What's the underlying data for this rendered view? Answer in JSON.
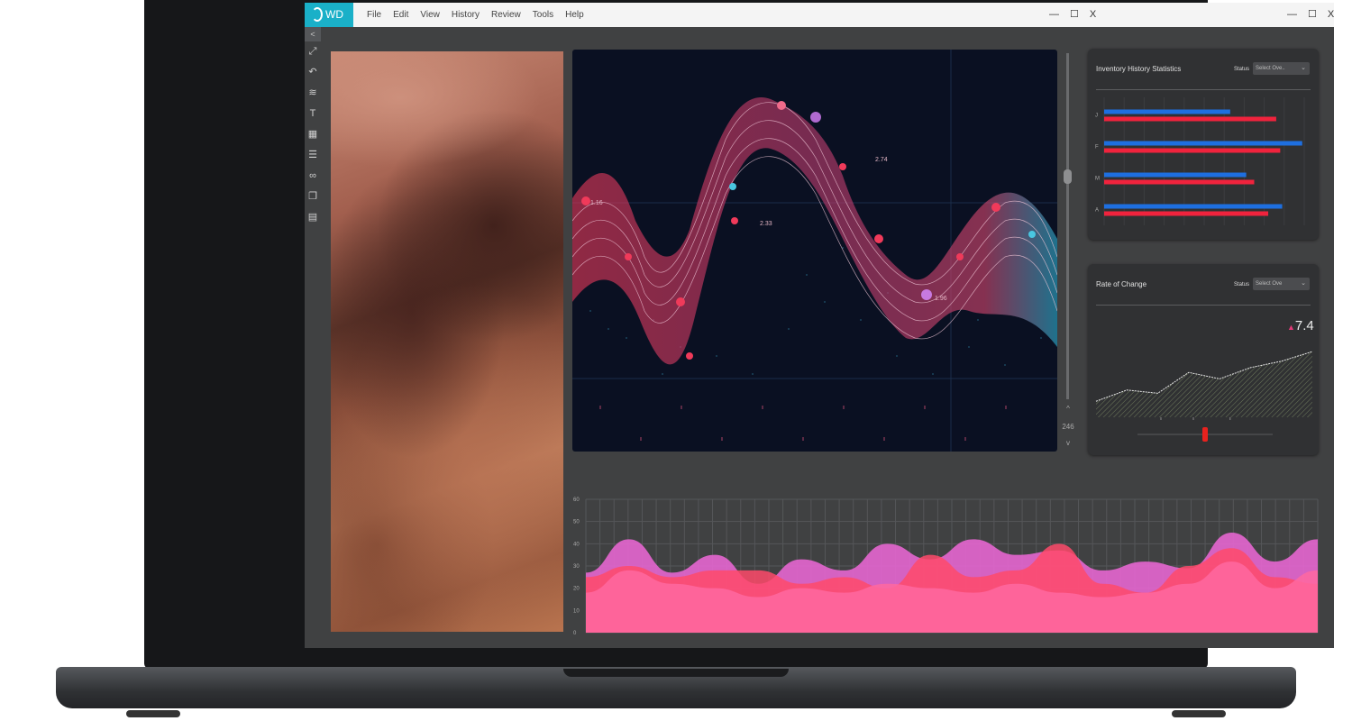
{
  "app": {
    "logo_text": "WD"
  },
  "menu": [
    "File",
    "Edit",
    "View",
    "History",
    "Review",
    "Tools",
    "Help"
  ],
  "window_controls": {
    "minimize": "—",
    "maximize": "☐",
    "close": "X"
  },
  "sidebar": {
    "collapse_label": "<",
    "tools": [
      {
        "name": "fit-screen-icon",
        "glyph": "⤢"
      },
      {
        "name": "undo-icon",
        "glyph": "↶"
      },
      {
        "name": "layers-icon",
        "glyph": "≋"
      },
      {
        "name": "text-tool-icon",
        "glyph": "T"
      },
      {
        "name": "grid-icon",
        "glyph": "▦"
      },
      {
        "name": "list-icon",
        "glyph": "☰"
      },
      {
        "name": "link-icon",
        "glyph": "∞"
      },
      {
        "name": "window-icon",
        "glyph": "❐"
      },
      {
        "name": "document-icon",
        "glyph": "▤"
      }
    ]
  },
  "zoom": {
    "value": "246",
    "up": "^",
    "down": "v"
  },
  "inventory_panel": {
    "title": "Inventory History Statistics",
    "status_label": "Status",
    "select_value": "Select Ove..",
    "chart_data": {
      "type": "bar",
      "orientation": "horizontal",
      "categories": [
        "J",
        "F",
        "M",
        "A"
      ],
      "series": [
        {
          "color": "#1e6fe0",
          "values": [
            0.63,
            0.99,
            0.71,
            0.89
          ]
        },
        {
          "color": "#f0233d",
          "values": [
            0.86,
            0.88,
            0.75,
            0.82
          ]
        }
      ]
    }
  },
  "rate_panel": {
    "title": "Rate of Change",
    "status_label": "Status",
    "select_value": "Select Ove",
    "value": "7.4",
    "trend": "up",
    "slider_value": 0.5,
    "chart_data": {
      "type": "area",
      "values": [
        10,
        17,
        15,
        28,
        24,
        31,
        35,
        41
      ]
    }
  },
  "main_chart": {
    "tags": [
      "1.16",
      "2.74",
      "2.33",
      "1.96"
    ]
  },
  "area_chart": {
    "chart_data": {
      "type": "area",
      "yticks": [
        0,
        10,
        20,
        30,
        40,
        50,
        60
      ],
      "ylim": [
        0,
        60
      ],
      "series": [
        {
          "color": "#e566d0",
          "values": [
            27,
            42,
            27,
            35,
            22,
            33,
            28,
            40,
            33,
            42,
            35,
            37,
            28,
            32,
            29,
            45,
            32,
            42
          ]
        },
        {
          "color": "#ff4a6a",
          "values": [
            25,
            30,
            25,
            28,
            28,
            22,
            25,
            20,
            35,
            25,
            28,
            40,
            22,
            18,
            30,
            38,
            25,
            22
          ]
        },
        {
          "color": "#ff69a0",
          "values": [
            18,
            28,
            22,
            20,
            16,
            20,
            18,
            22,
            20,
            18,
            22,
            18,
            16,
            18,
            22,
            32,
            20,
            28
          ]
        }
      ]
    }
  }
}
